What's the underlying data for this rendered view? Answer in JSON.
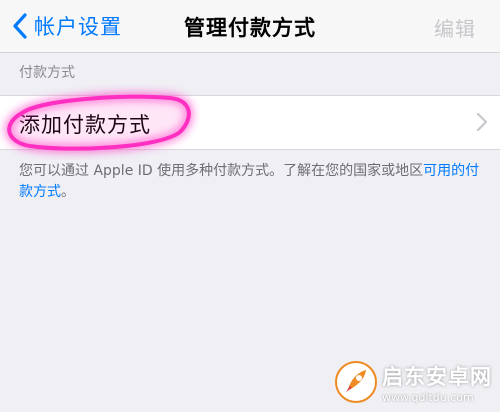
{
  "navbar": {
    "back_label": "帐户设置",
    "title": "管理付款方式",
    "edit_label": "编辑"
  },
  "section": {
    "header": "付款方式",
    "cell_label": "添加付款方式"
  },
  "footer": {
    "text": "您可以通过 Apple ID 使用多种付款方式。了解在您的国家或地区",
    "link": "可用的付款方式",
    "end": "。"
  },
  "watermark": {
    "title": "启东安卓网",
    "url": "www.qdltdu.com"
  },
  "colors": {
    "accent": "#007aff",
    "background": "#efeff4",
    "highlight": "#ff2fc1",
    "disabled": "#c7c7cc"
  },
  "icons": {
    "back": "chevron-left-icon",
    "disclosure": "chevron-right-icon",
    "watermark_logo": "rocket-logo-icon"
  }
}
